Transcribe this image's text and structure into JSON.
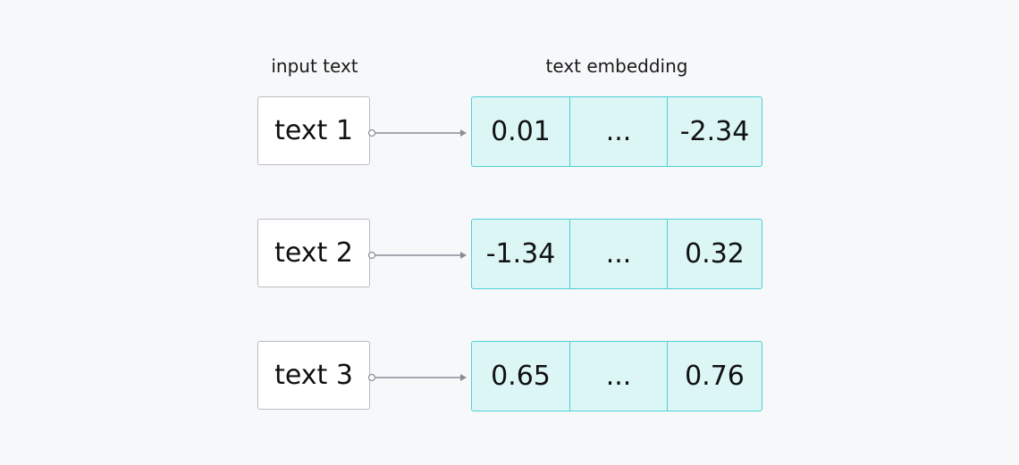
{
  "headers": {
    "input": "input text",
    "embedding": "text embedding"
  },
  "rows": [
    {
      "input": "text 1",
      "values": [
        "0.01",
        "...",
        "-2.34"
      ]
    },
    {
      "input": "text 2",
      "values": [
        "-1.34",
        "...",
        "0.32"
      ]
    },
    {
      "input": "text 3",
      "values": [
        "0.65",
        "...",
        "0.76"
      ]
    }
  ],
  "colors": {
    "embedding_fill": "#dcf6f6",
    "embedding_border": "#4fd0d4",
    "arrow": "#8a8d96"
  }
}
